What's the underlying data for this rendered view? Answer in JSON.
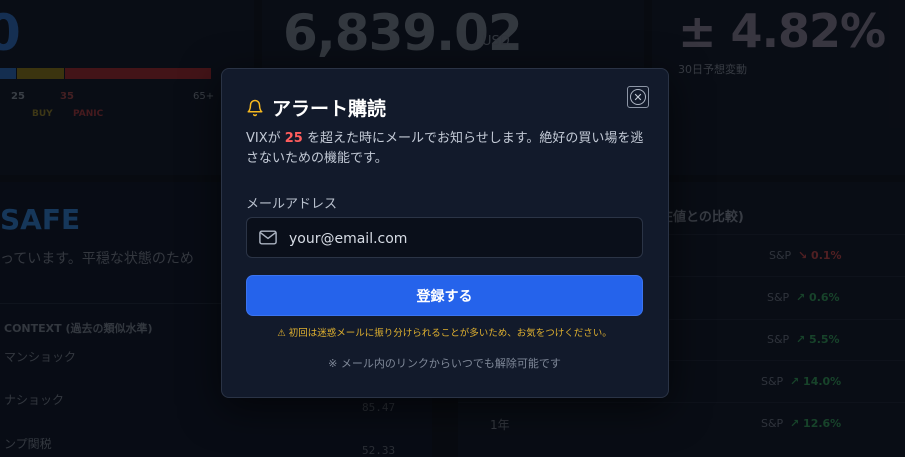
{
  "background": {
    "left_value": "0",
    "price": "6,839.02",
    "price_unit": "USD",
    "change": "± 4.82%",
    "change_caption": "30日予想変動",
    "scale_ticks": [
      "25",
      "35",
      "65+"
    ],
    "scale_labels": [
      "BUY",
      "PANIC"
    ],
    "status": "SAFE",
    "status_text": "っています。平穏な状態のため",
    "context_title": "CONTEXT (過去の類似水準)",
    "events": [
      {
        "name": "マンショック",
        "value": ""
      },
      {
        "name": "ナショック",
        "value": "85.47"
      },
      {
        "name": "ンプ関税",
        "value": "52.33"
      }
    ],
    "compare_title": "在値との比較)",
    "compare_rows": [
      {
        "label": "S&P",
        "change": "↘ 0.1%",
        "color": "#ff5d5d"
      },
      {
        "label": "S&P",
        "change": "↗ 0.6%",
        "color": "#22c55e"
      },
      {
        "label": "S&P",
        "change": "↗ 5.5%",
        "color": "#22c55e"
      },
      {
        "label": "S&P",
        "change": "↗ 14.0%",
        "color": "#22c55e"
      },
      {
        "label": "S&P",
        "change": "↗ 12.6%",
        "color": "#22c55e"
      }
    ],
    "last_period": "1年"
  },
  "modal": {
    "title": "アラート購読",
    "desc_prefix": "VIXが ",
    "desc_threshold": "25",
    "desc_suffix": " を超えた時にメールでお知らせします。絶好の買い場を逃さないための機能です。",
    "email_label": "メールアドレス",
    "email_placeholder": "your@email.com",
    "submit_label": "登録する",
    "warning": "⚠ 初回は迷惑メールに振り分けられることが多いため、お気をつけください。",
    "note": "※ メール内のリンクからいつでも解除可能です",
    "close_icon": "close-icon",
    "accent_color": "#2563eb",
    "highlight_color": "#ff5d5d",
    "warning_color": "#e0b12f"
  }
}
